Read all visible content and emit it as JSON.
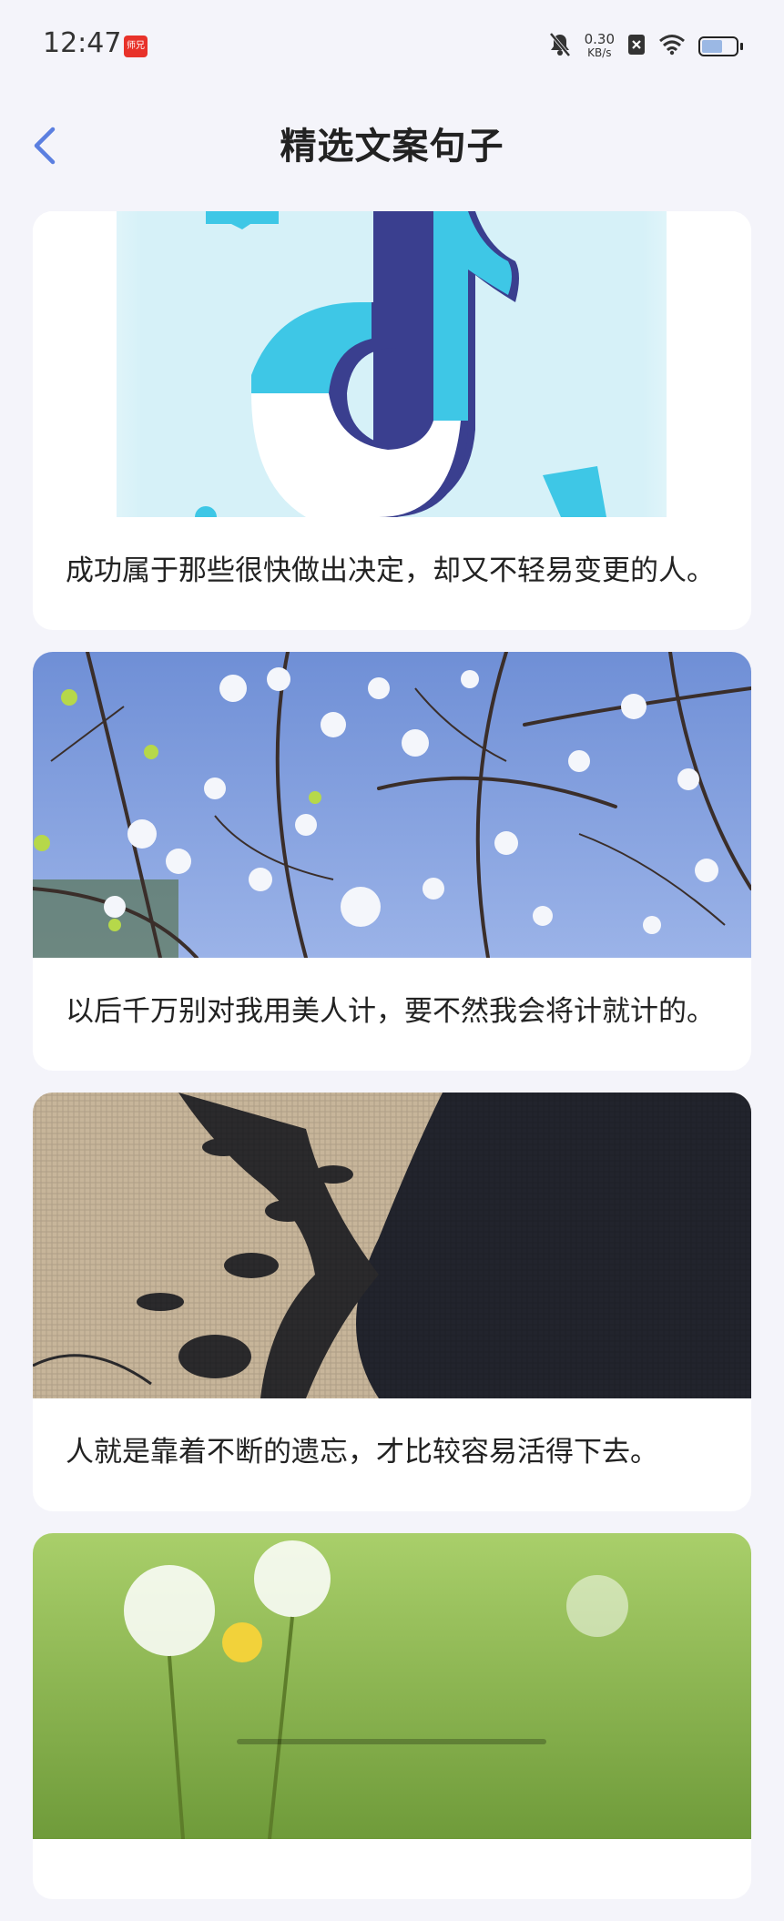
{
  "status_bar": {
    "time": "12:47",
    "app_badge": "师兄",
    "net_speed_value": "0.30",
    "net_speed_unit": "KB/s",
    "icons": [
      "mute-icon",
      "sim-off-icon",
      "wifi-icon",
      "battery-icon"
    ],
    "battery_level": 0.6
  },
  "header": {
    "title": "精选文案句子",
    "back_icon": "chevron-left-icon",
    "accent_color": "#5b7fe0"
  },
  "cards": [
    {
      "image": "tiktok-logo-image",
      "text": "成功属于那些很快做出决定，却又不轻易变更的人。"
    },
    {
      "image": "white-blossom-branches-image",
      "text": "以后千万别对我用美人计，要不然我会将计就计的。"
    },
    {
      "image": "plant-shadow-on-fabric-image",
      "text": "人就是靠着不断的遗忘，才比较容易活得下去。"
    },
    {
      "image": "dandelion-field-image",
      "text": ""
    }
  ]
}
